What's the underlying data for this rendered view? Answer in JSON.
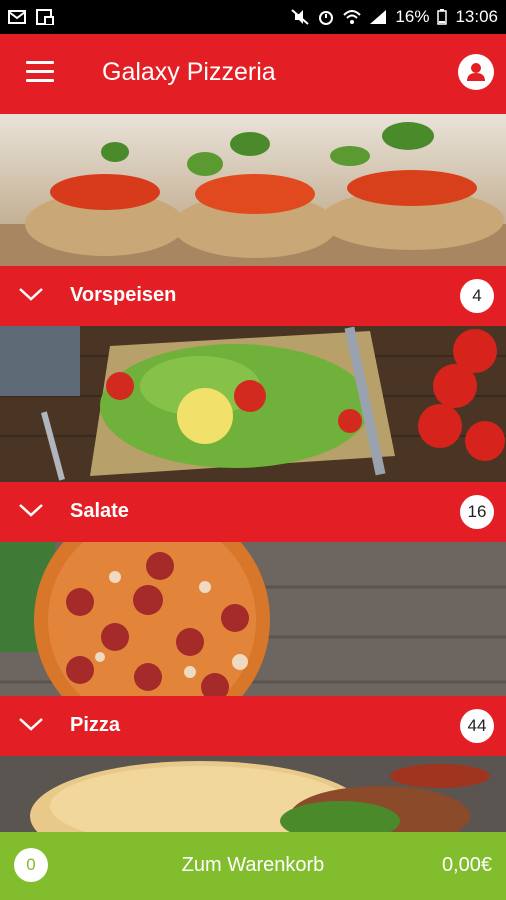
{
  "status_bar": {
    "battery": "16%",
    "time": "13:06",
    "left_icons": [
      "mail-icon",
      "image-icon"
    ],
    "right_icons": [
      "mute-icon",
      "alarm-icon",
      "wifi-icon",
      "signal-icon",
      "battery-icon"
    ]
  },
  "app_bar": {
    "title": "Galaxy Pizzeria",
    "menu_icon": "hamburger-menu-icon",
    "profile_icon": "user-icon"
  },
  "categories": [
    {
      "label": "Vorspeisen",
      "count": "4"
    },
    {
      "label": "Salate",
      "count": "16"
    },
    {
      "label": "Pizza",
      "count": "44"
    }
  ],
  "cart": {
    "count": "0",
    "label": "Zum Warenkorb",
    "total": "0,00€"
  },
  "colors": {
    "primary_red": "#e31e24",
    "cart_green": "#82bd2e"
  }
}
